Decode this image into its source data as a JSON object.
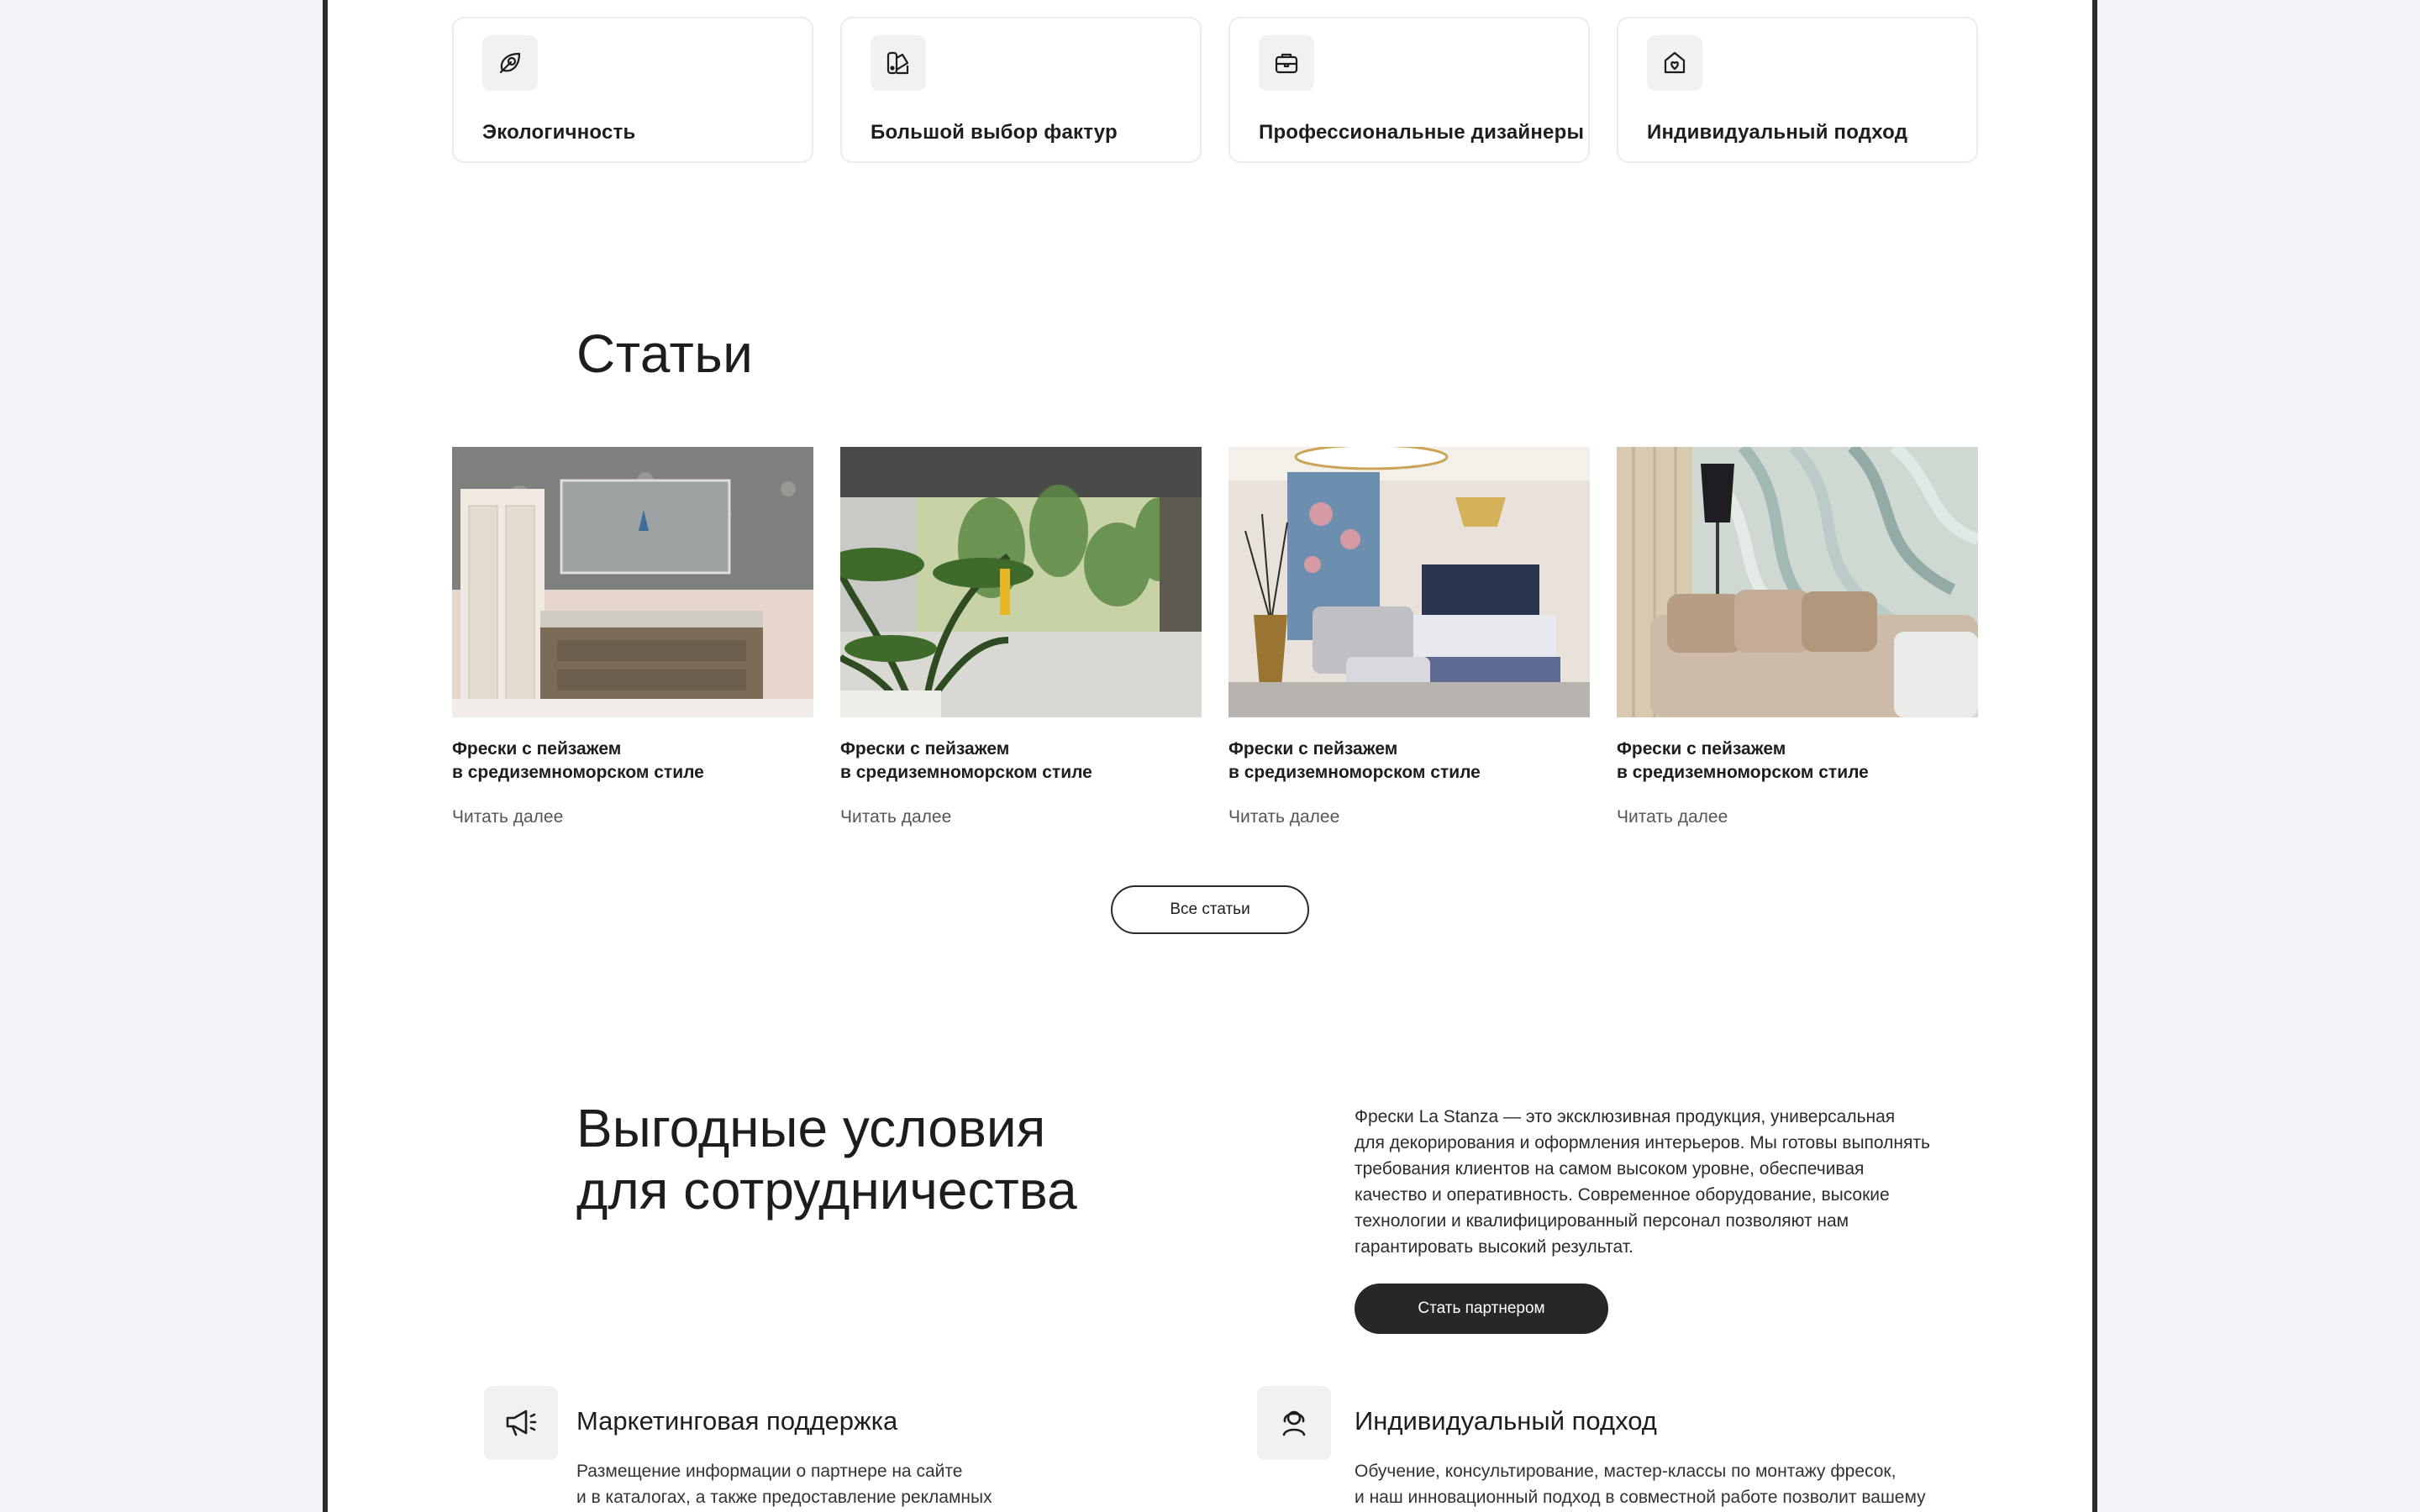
{
  "features": [
    {
      "label": "Экологичность",
      "icon": "leaf-icon"
    },
    {
      "label": "Большой выбор фактур",
      "icon": "palette-icon"
    },
    {
      "label": "Профессиональные дизайнеры",
      "icon": "briefcase-icon"
    },
    {
      "label": "Индивидуальный подход",
      "icon": "heart-home-icon"
    }
  ],
  "articles_section": {
    "title": "Статьи",
    "items": [
      {
        "title_line1": "Фрески с пейзажем",
        "title_line2": "в средиземноморском стиле",
        "link": "Читать далее",
        "image": "bathroom-photo"
      },
      {
        "title_line1": "Фрески с пейзажем",
        "title_line2": "в средиземноморском стиле",
        "link": "Читать далее",
        "image": "tropical-room-photo"
      },
      {
        "title_line1": "Фрески с пейзажем",
        "title_line2": "в средиземноморском стиле",
        "link": "Читать далее",
        "image": "bedroom-photo"
      },
      {
        "title_line1": "Фрески с пейзажем",
        "title_line2": "в средиземноморском стиле",
        "link": "Читать далее",
        "image": "marble-sofa-photo"
      }
    ],
    "all_button": "Все статьи"
  },
  "cooperation": {
    "title_line1": "Выгодные условия",
    "title_line2": "для сотрудничества",
    "description_lines": [
      "Фрески La Stanza — это эксклюзивная продукция, универсальная",
      "для декорирования и оформления интерьеров. Мы готовы выполнять",
      "требования клиентов на самом высоком уровне, обеспечивая",
      "качество и оперативность. Современное оборудование, высокие",
      "технологии и квалифицированный персонал позволяют нам",
      "гарантировать высокий результат."
    ],
    "partner_button": "Стать партнером"
  },
  "benefits": [
    {
      "title": "Маркетинговая поддержка",
      "icon": "megaphone-icon",
      "text_line1": "Размещение информации о партнере на сайте",
      "text_line2": "и в каталогах, а также предоставление рекламных"
    },
    {
      "title": "Индивидуальный подход",
      "icon": "person-icon",
      "text_line1": "Обучение, консультирование, мастер-классы по монтажу фресок,",
      "text_line2": "и наш инновационный подход в совместной работе позволит вашему"
    }
  ],
  "colors": {
    "background": "#f3f4f8",
    "accent_dark": "#272727",
    "card_border": "#ececec"
  }
}
